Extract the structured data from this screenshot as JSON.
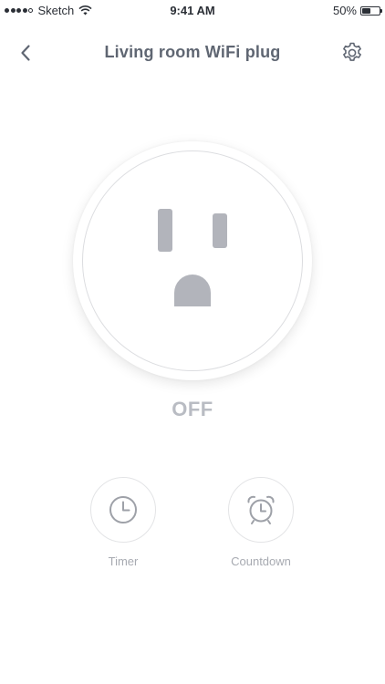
{
  "status_bar": {
    "carrier": "Sketch",
    "time": "9:41 AM",
    "battery_percent": "50%",
    "battery_level": 0.5
  },
  "nav": {
    "title": "Living room WiFi plug",
    "back_icon": "chevron-left-icon",
    "settings_icon": "gear-icon"
  },
  "plug": {
    "state": "OFF",
    "icon": "outlet-icon"
  },
  "actions": [
    {
      "label": "Timer",
      "icon": "clock-icon"
    },
    {
      "label": "Countdown",
      "icon": "alarm-clock-icon"
    }
  ],
  "colors": {
    "title": "#5f6672",
    "state_off": "#b9bcc3",
    "outlet": "#b2b4bb",
    "action_icon": "#9ea1a8",
    "action_label": "#a7aab1"
  }
}
